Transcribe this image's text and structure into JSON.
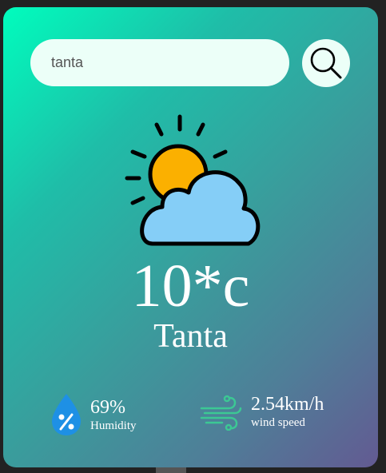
{
  "search": {
    "value": "tanta",
    "placeholder": ""
  },
  "search_button": {
    "icon": "search-icon"
  },
  "weather": {
    "icon": "partly-cloudy-icon",
    "temperature": "10*c",
    "city": "Tanta"
  },
  "humidity": {
    "value": "69%",
    "label": "Humidity",
    "icon": "humidity-drop-icon"
  },
  "wind": {
    "value": "2.54km/h",
    "label": "wind speed",
    "icon": "wind-icon"
  },
  "colors": {
    "gradient_start": "#00fdbd",
    "gradient_end": "#635a92",
    "search_background": "#ecfff8",
    "sun": "#fbb000",
    "cloud": "#85cef7",
    "drop": "#1e90e5",
    "wind_icon": "#3cc894"
  }
}
